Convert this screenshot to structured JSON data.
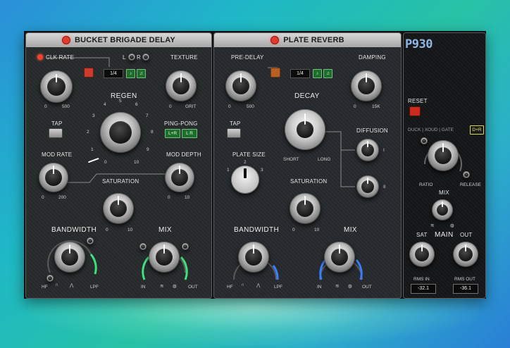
{
  "bbd": {
    "title": "BUCKET BRIGADE DELAY",
    "clk_rate": "CLK RATE",
    "clk_min": "0",
    "clk_max": "500",
    "lr_l": "L",
    "lr_r": "R",
    "sync_value": "1/4",
    "texture": "TEXTURE",
    "texture_max": "GRIT",
    "tap": "TAP",
    "regen": "REGEN",
    "regen_ticks": [
      "0",
      "1",
      "2",
      "3",
      "4",
      "5",
      "6",
      "7",
      "8",
      "9",
      "10"
    ],
    "pingpong": "PING-PONG",
    "pp_btn1": "L+R",
    "pp_btn2": "L R",
    "mod_rate": "MOD RATE",
    "mod_rate_min": "0",
    "mod_rate_max": "200",
    "mod_depth": "MOD DEPTH",
    "mod_depth_min": "0",
    "mod_depth_max": "10",
    "saturation": "SATURATION",
    "sat_min": "0",
    "sat_max": "10",
    "bandwidth": "BANDWIDTH",
    "bw_left": "HF",
    "bw_right": "LPF",
    "mix": "MIX",
    "mix_in": "IN",
    "mix_out": "OUT"
  },
  "plate": {
    "title": "PLATE REVERB",
    "predelay": "PRE-DELAY",
    "pd_min": "0",
    "pd_max": "500",
    "sync_value": "1/4",
    "damping": "DAMPING",
    "damp_min": "0",
    "damp_max": "15K",
    "tap": "TAP",
    "decay": "DECAY",
    "decay_short": "SHORT",
    "decay_long": "LONG",
    "diffusion": "DIFFUSION",
    "diff_1": "I",
    "diff_2": "II",
    "plate_size": "PLATE SIZE",
    "ps_ticks": [
      "1",
      "2",
      "3"
    ],
    "saturation": "SATURATION",
    "sat_min": "0",
    "sat_max": "10",
    "bandwidth": "BANDWIDTH",
    "mix": "MIX",
    "mix_in": "IN",
    "mix_out": "OUT"
  },
  "master": {
    "logo": "P930",
    "reset": "RESET",
    "modes": "DUCK | XOUD | GATE",
    "mode_btn": "D+R",
    "ratio": "RATIO",
    "release": "RELEASE",
    "mix": "MIX",
    "sat": "SAT",
    "main": "MAIN",
    "out": "OUT",
    "rms_in_label": "RMS IN",
    "rms_out_label": "RMS OUT",
    "rms_in_value": "-32.1",
    "rms_out_value": "-36.1"
  },
  "colors": {
    "accent_green": "#3fe07e",
    "accent_blue": "#3a7dff",
    "power_red": "#e03b2d"
  }
}
